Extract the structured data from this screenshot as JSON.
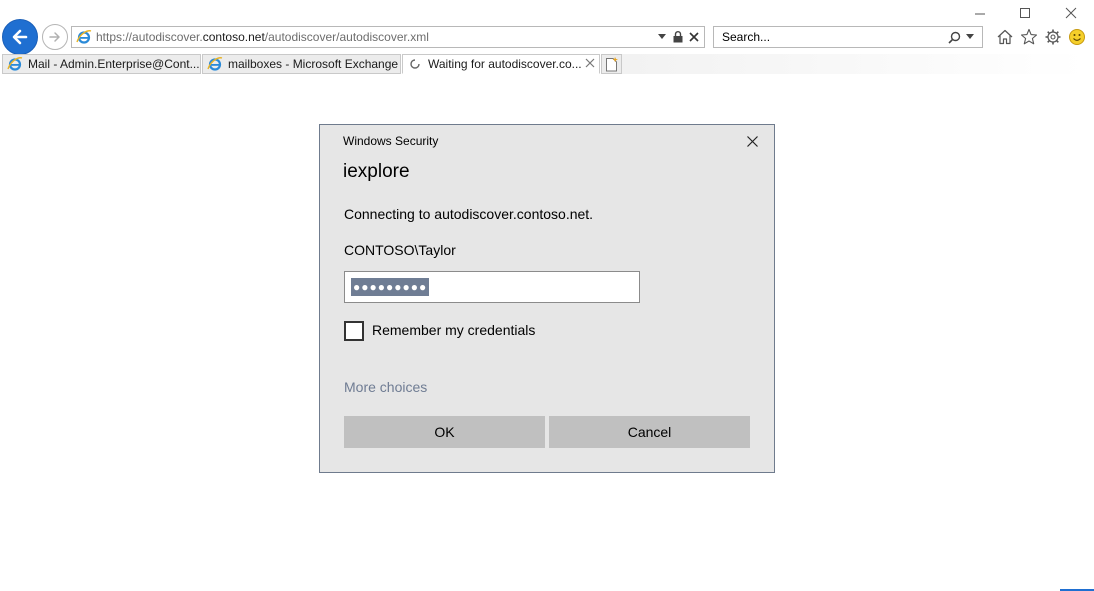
{
  "window": {
    "controls": [
      "minimize-icon",
      "maximize-icon",
      "close-icon"
    ]
  },
  "navigation": {
    "back_icon": "back-arrow-icon",
    "forward_icon": "forward-arrow-icon",
    "url_prefix": "https://autodiscover.",
    "url_host": "contoso.net",
    "url_path": "/autodiscover/autodiscover.xml",
    "address_icons": [
      "ie-logo-icon",
      "dropdown-arrow-icon",
      "lock-icon",
      "stop-icon"
    ],
    "search_placeholder": "Search...",
    "toolbar_icons": [
      "home-icon",
      "favorites-star-icon",
      "gear-icon",
      "smiley-feedback-icon"
    ]
  },
  "tabs": [
    {
      "label": "Mail - Admin.Enterprise@Cont...",
      "icon": "ie-logo-icon",
      "active": false
    },
    {
      "label": "mailboxes - Microsoft Exchange",
      "icon": "ie-logo-icon",
      "active": false
    },
    {
      "label": "Waiting for autodiscover.co...",
      "icon": "loading-spinner-icon",
      "active": true
    }
  ],
  "new_tab_icon": "new-tab-icon",
  "dialog": {
    "caption": "Windows Security",
    "app_name": "iexplore",
    "message": "Connecting to autodiscover.contoso.net.",
    "username": "CONTOSO\\Taylor",
    "password_mask": "●●●●●●●●●",
    "remember_label": "Remember my credentials",
    "remember_checked": false,
    "more_choices": "More choices",
    "ok_label": "OK",
    "cancel_label": "Cancel"
  },
  "colors": {
    "accent": "#1f6fd1",
    "dialog_bg": "#e6e6e6",
    "button_bg": "#c0c0c0",
    "link": "#6f7c93",
    "selection": "#6f7d94"
  }
}
